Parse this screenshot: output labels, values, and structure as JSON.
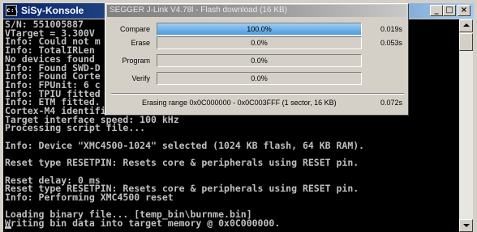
{
  "console": {
    "title": "SiSy-Konsole",
    "app_icon_text": "c:\\",
    "buttons": {
      "minimize": "_",
      "maximize": "□",
      "close": "×"
    },
    "lines": [
      "S/N: 551005887",
      "VTarget = 3.300V",
      "Info: Could not m",
      "Info: TotalIRLen",
      "No devices found",
      "Info: Found SWD-D",
      "Info: Found Corte",
      "Info: FPUnit: 6 c",
      "Info: TPIU fitted",
      "Info: ETM fitted.",
      "Cortex-M4 identified.",
      "Target interface speed: 100 kHz",
      "Processing script file...",
      "",
      "Info: Device \"XMC4500-1024\" selected (1024 KB flash, 64 KB RAM).",
      "",
      "Reset type RESETPIN: Resets core & peripherals using RESET pin.",
      "",
      "Reset delay: 0 ms",
      "Reset type RESETPIN: Resets core & peripherals using RESET pin.",
      "Info: Performing XMC4500 reset",
      "",
      "Loading binary file... [temp_bin\\burnme.bin]",
      "Writing bin data into target memory @ 0x0C000000."
    ]
  },
  "dialog": {
    "title": "SEGGER J-Link V4.78l - Flash download (16 KB)",
    "rows": [
      {
        "label": "Compare",
        "percent_text": "100.0%",
        "progress": 1.0,
        "time": "0.019s"
      },
      {
        "label": "Erase",
        "percent_text": "0.0%",
        "progress": 0.0,
        "time": "0.053s"
      },
      {
        "label": "Program",
        "percent_text": "0.0%",
        "progress": 0.0,
        "time": ""
      },
      {
        "label": "Verify",
        "percent_text": "0.0%",
        "progress": 0.0,
        "time": ""
      }
    ],
    "status": "Erasing range 0x0C000000 - 0x0C003FFF (1 sector, 16 KB)",
    "status_time": "0.072s"
  },
  "colors": {
    "progress_fill_top": "#9fcdf2",
    "progress_fill_bottom": "#4a9be0",
    "console_bg": "#000000",
    "console_text": "#c0c0c0"
  }
}
